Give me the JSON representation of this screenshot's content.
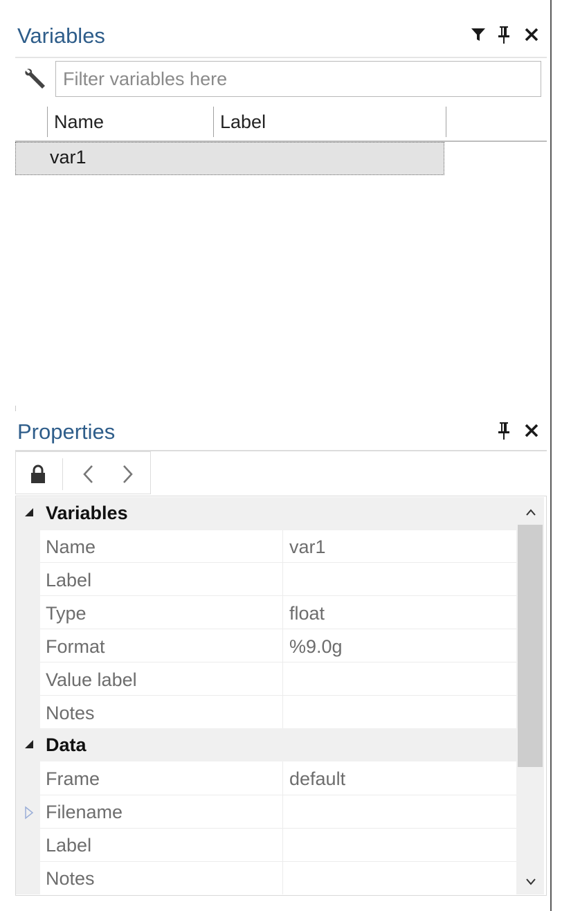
{
  "variables_panel": {
    "title": "Variables",
    "filter": {
      "placeholder": "Filter variables here",
      "value": ""
    },
    "columns": [
      "Name",
      "Label"
    ],
    "rows": [
      {
        "name": "var1",
        "label": ""
      }
    ],
    "icons": {
      "filter": "filter-icon",
      "pin": "pin-icon",
      "close": "close-icon",
      "wrench": "wrench-icon"
    }
  },
  "properties_panel": {
    "title": "Properties",
    "toolbar": {
      "lock": "lock-icon",
      "back": "chevron-left-icon",
      "forward": "chevron-right-icon"
    },
    "categories": [
      {
        "label": "Variables",
        "rows": [
          {
            "name": "Name",
            "value": "var1"
          },
          {
            "name": "Label",
            "value": ""
          },
          {
            "name": "Type",
            "value": "float"
          },
          {
            "name": "Format",
            "value": "%9.0g"
          },
          {
            "name": "Value label",
            "value": ""
          },
          {
            "name": "Notes",
            "value": ""
          }
        ]
      },
      {
        "label": "Data",
        "rows": [
          {
            "name": "Frame",
            "value": "default"
          },
          {
            "name": "Filename",
            "value": ""
          },
          {
            "name": "Label",
            "value": ""
          },
          {
            "name": "Notes",
            "value": ""
          }
        ]
      }
    ]
  },
  "colors": {
    "title": "#2e5d8a",
    "selection": "#e3e3e3",
    "scroll_thumb": "#cdcdcd"
  }
}
